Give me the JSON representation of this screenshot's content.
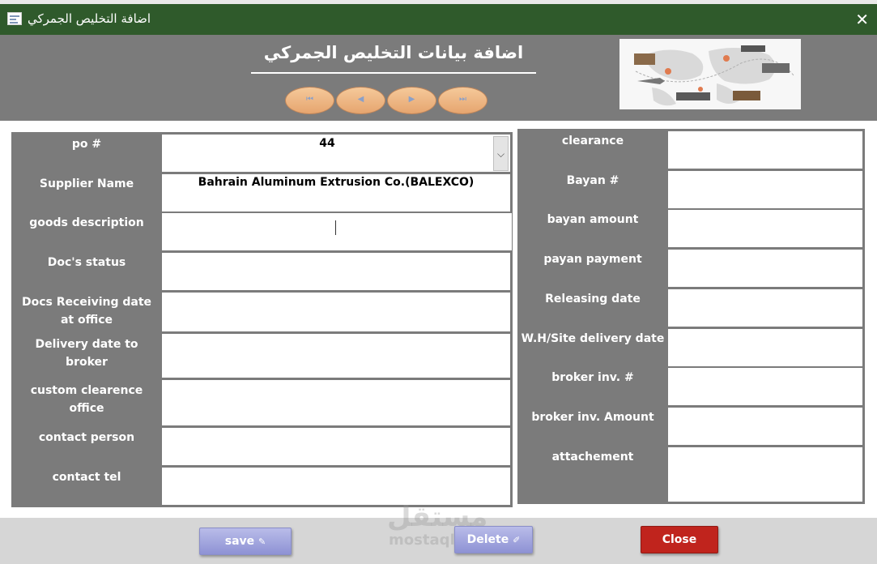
{
  "window": {
    "title": "اضافة التخليص الجمركي",
    "close_glyph": "✕",
    "icon": "form-icon"
  },
  "header": {
    "form_title": "اضافة بيانات التخليص الجمركي",
    "nav": {
      "first": "⏮",
      "prev": "◀",
      "next": "▶",
      "last": "⏭"
    },
    "image": "world-logistics-map-image"
  },
  "left_fields": [
    {
      "label": "po #",
      "value": "44",
      "type": "combo"
    },
    {
      "label": "Supplier Name",
      "value": "Bahrain Aluminum Extrusion Co.(BALEXCO)"
    },
    {
      "label": "goods description",
      "value": ""
    },
    {
      "label": "Doc's status",
      "value": ""
    },
    {
      "label": "Docs Receiving date at office",
      "value": ""
    },
    {
      "label": "Delivery date to broker",
      "value": ""
    },
    {
      "label": "custom clearence office",
      "value": ""
    },
    {
      "label": "contact person",
      "value": ""
    },
    {
      "label": "contact tel",
      "value": ""
    }
  ],
  "right_fields": [
    {
      "label": "clearance",
      "value": ""
    },
    {
      "label": "Bayan #",
      "value": ""
    },
    {
      "label": "bayan amount",
      "value": ""
    },
    {
      "label": "payan payment",
      "value": ""
    },
    {
      "label": "Releasing date",
      "value": ""
    },
    {
      "label": "W.H/Site delivery date",
      "value": ""
    },
    {
      "label": "broker inv. #",
      "value": ""
    },
    {
      "label": "broker inv. Amount",
      "value": ""
    },
    {
      "label": "attachement",
      "value": ""
    }
  ],
  "footer": {
    "save_label": "save",
    "save_icon": "save-icon",
    "delete_label": "Delete",
    "delete_icon": "delete-icon",
    "close_label": "Close"
  },
  "watermark": {
    "arabic": "مستقل",
    "latin": "mostaql.com"
  },
  "colors": {
    "title_bar": "#2f5a2b",
    "panel_gray": "#7b7b7b",
    "nav_button": "#e6a56f",
    "save_button": "#8e92d4",
    "close_button": "#c0241d"
  }
}
